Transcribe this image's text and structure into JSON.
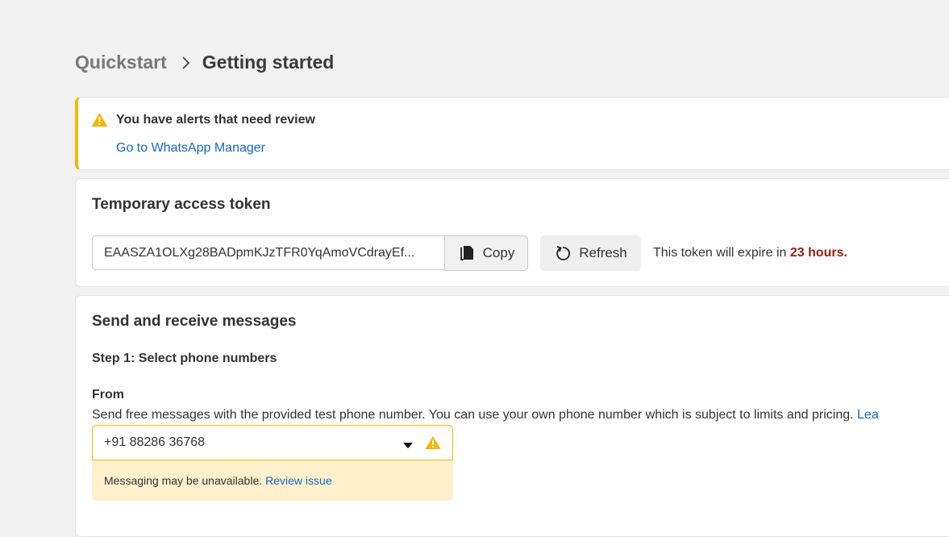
{
  "breadcrumb": {
    "root": "Quickstart",
    "current": "Getting started"
  },
  "alert": {
    "title": "You have alerts that need review",
    "link": "Go to WhatsApp Manager",
    "icon": "warning-icon",
    "accent_color": "#f5b700"
  },
  "token": {
    "title": "Temporary access token",
    "value": "EAASZA1OLXg28BADpmKJzTFR0YqAmoVCdrayEf...",
    "copy_label": "Copy",
    "refresh_label": "Refresh",
    "expire_prefix": "This token will expire in",
    "expire_hours": "23 hours."
  },
  "messages": {
    "title": "Send and receive messages",
    "step1_title": "Step 1: Select phone numbers",
    "from_label": "From",
    "from_description": "Send free messages with the provided test phone number. You can use your own phone number which is subject to limits and pricing.",
    "learn_link": "Lea",
    "phone_selected": "+91 88286 36768",
    "warning_text": "Messaging may be unavailable.",
    "review_link": "Review issue"
  },
  "colors": {
    "link": "#1767c4",
    "warning": "#f5b700",
    "warning_bg": "#fdf0cb",
    "expire": "#9a1d0e"
  }
}
